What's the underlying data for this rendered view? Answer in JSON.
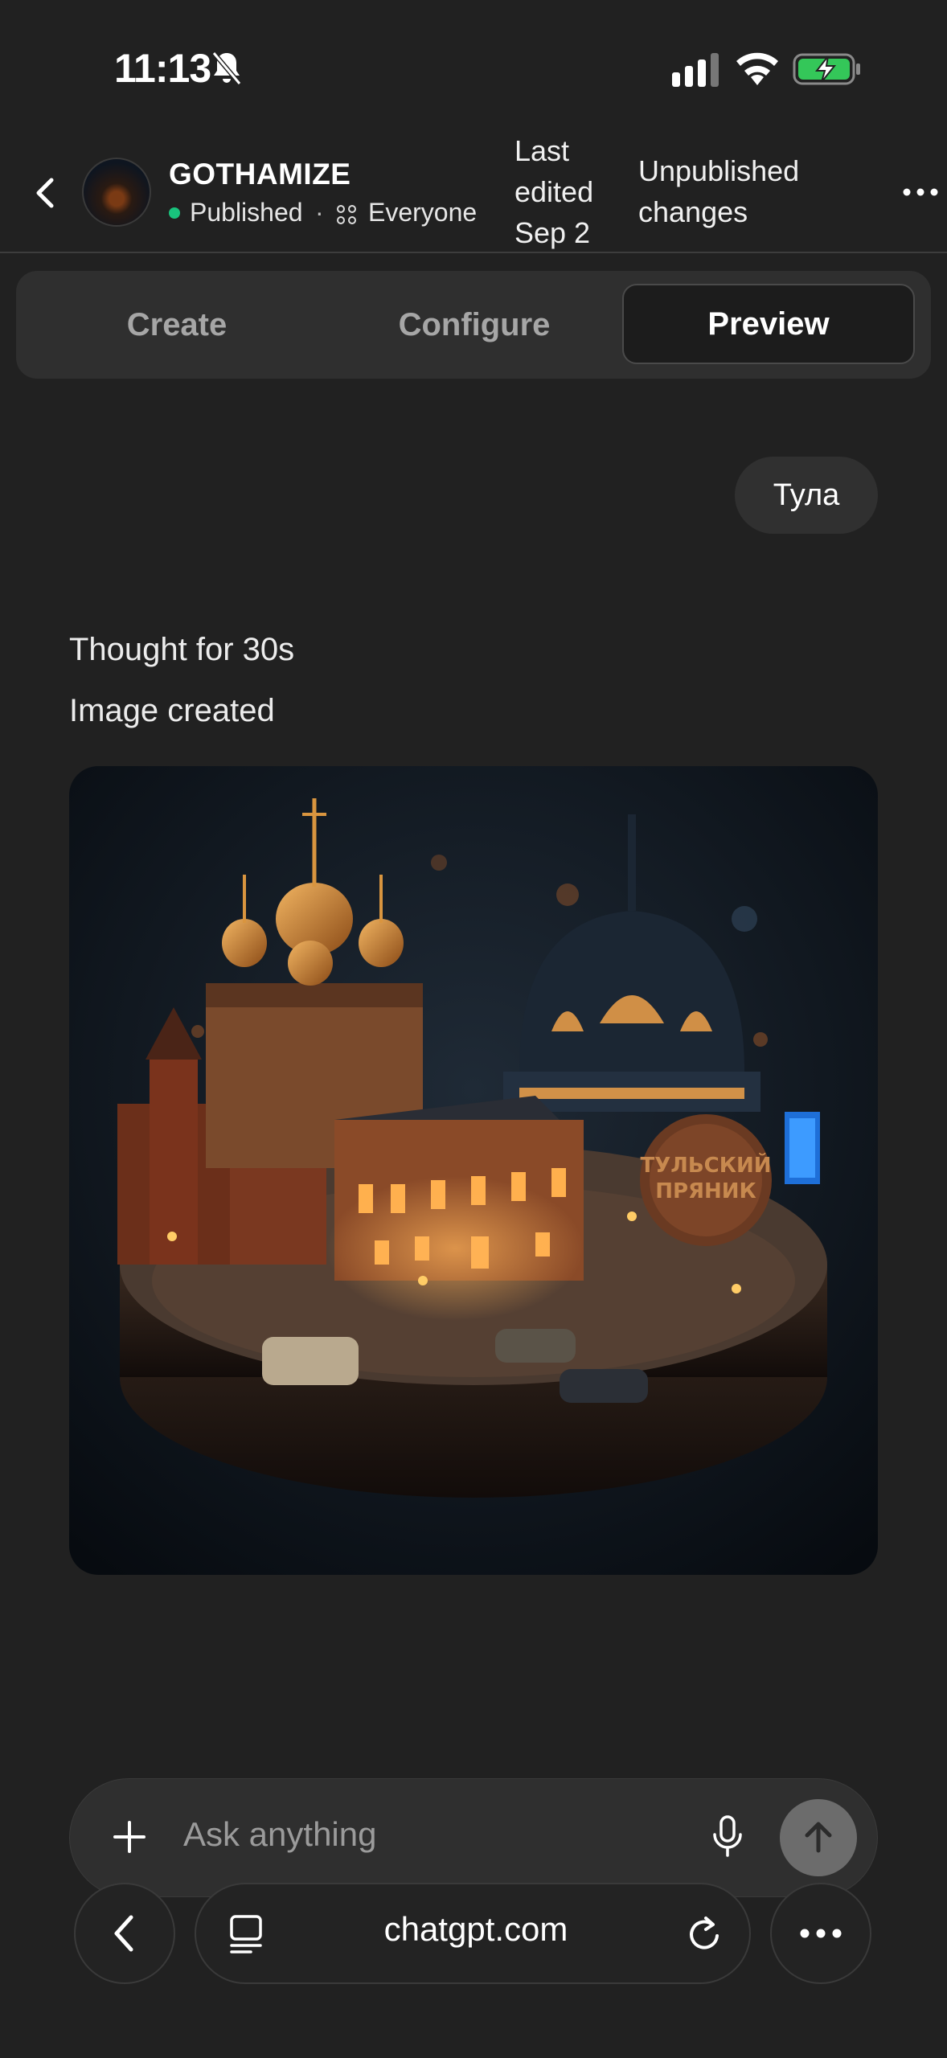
{
  "status_bar": {
    "time": "11:13",
    "icons": [
      "bell-slash-icon",
      "cellular-signal-icon",
      "wifi-icon",
      "battery-charging-icon"
    ]
  },
  "header": {
    "gpt_name": "GOTHAMIZE",
    "status": "Published",
    "separator": "·",
    "audience": "Everyone",
    "last_edited": "Last edited Sep 2",
    "unpublished": "Unpublished changes",
    "icons": [
      "chevron-left-icon",
      "everyone-icon",
      "more-horizontal-icon"
    ]
  },
  "tabs": [
    {
      "label": "Create"
    },
    {
      "label": "Configure"
    },
    {
      "label": "Preview",
      "active": true
    }
  ],
  "chat": {
    "user_message": "Тула",
    "thought": "Thought for 30s",
    "image_status": "Image created",
    "image_sign_text": "ТУЛЬСКИЙ ПРЯНИК"
  },
  "composer": {
    "placeholder": "Ask anything",
    "icons": [
      "plus-icon",
      "microphone-icon",
      "arrow-up-icon"
    ]
  },
  "browser": {
    "url": "chatgpt.com",
    "icons": [
      "back-icon",
      "reader-icon",
      "reload-icon",
      "more-icon"
    ]
  },
  "colors": {
    "background": "#212121",
    "surface": "#2f2f2f",
    "published_dot": "#19c37d",
    "battery": "#34c759",
    "send_button": "#6c6c6c"
  }
}
